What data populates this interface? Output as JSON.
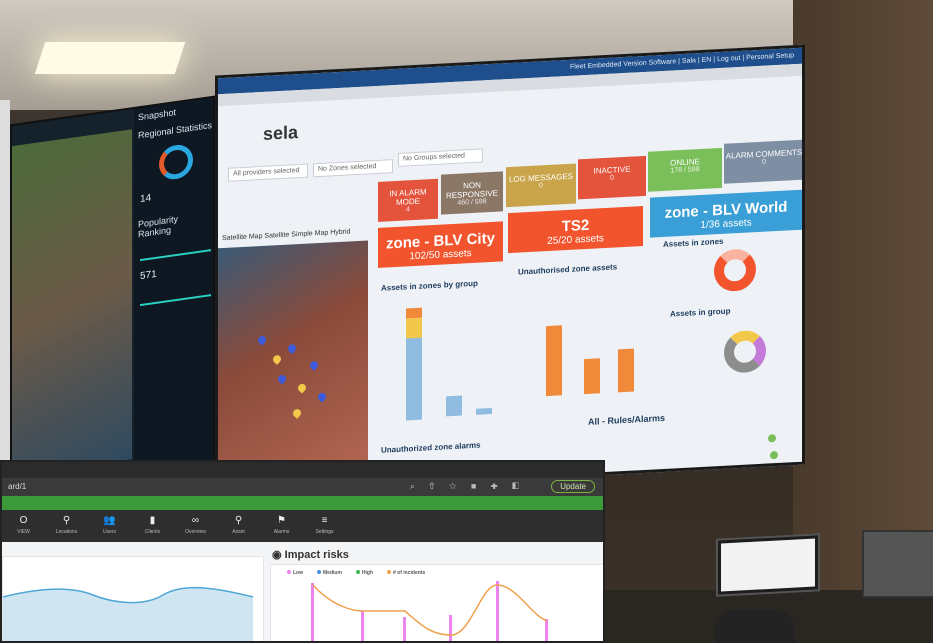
{
  "colors": {
    "alarm": "#e4543c",
    "non_responsive": "#8b7766",
    "log_messages": "#c9a44a",
    "inactive": "#e4543c",
    "online": "#7bbf5a",
    "alarm_comments": "#7f8fa3",
    "zone_blv": "#f2542d",
    "zone_world": "#3a9fd6",
    "bar_blue": "#8fbce0",
    "bar_orange": "#f08a3a",
    "bar_yellow": "#f2c84b",
    "green_bar": "#3d9a3b"
  },
  "video_wall": {
    "left_panel": {
      "title": "Snapshot",
      "section": "Regional Statistics",
      "section2": "Popularity Ranking",
      "gauge_value": "14",
      "stat1": "571"
    },
    "dashboard": {
      "top_bar": "Fleet Embedded Version Software | Sala | EN | Log out | Personal Setup",
      "logo": "sela",
      "dropdowns": [
        "All providers selected",
        "No Zones selected",
        "No Groups selected"
      ],
      "tiles": [
        {
          "label": "IN ALARM MODE",
          "value": "4"
        },
        {
          "label": "NON RESPONSIVE",
          "value": "460 / 598"
        },
        {
          "label": "LOG MESSAGES",
          "value": "0"
        },
        {
          "label": "INACTIVE",
          "value": "0"
        },
        {
          "label": "ONLINE",
          "value": "178 / 598"
        },
        {
          "label": "ALARM COMMENTS",
          "value": "0"
        }
      ],
      "zones": [
        {
          "name": "zone - BLV City",
          "assets": "102/50 assets"
        },
        {
          "name": "TS2",
          "assets": "25/20 assets"
        },
        {
          "name": "zone - BLV World",
          "assets": "1/36 assets"
        }
      ],
      "map_tabs": [
        "Satellite Map",
        "Satellite Simple",
        "Map",
        "Hybrid"
      ],
      "sections": {
        "assets_by_group": "Assets in zones by group",
        "unauthorised_assets": "Unauthorised zone assets",
        "assets_in_zones": "Assets in zones",
        "assets_in_group": "Assets in group",
        "unauthorized_alarms": "Unauthorized zone alarms",
        "rules_alarms": "All - Rules/Alarms"
      }
    }
  },
  "laptop": {
    "address": "ard/1",
    "update_label": "Update",
    "nav_items": [
      {
        "icon": "O",
        "label": "VIEW"
      },
      {
        "icon": "⚲",
        "label": "Locations"
      },
      {
        "icon": "👥",
        "label": "Users"
      },
      {
        "icon": "▮",
        "label": "Clients"
      },
      {
        "icon": "∞",
        "label": "Overview"
      },
      {
        "icon": "⚲",
        "label": "Asset"
      },
      {
        "icon": "⚑",
        "label": "Alarms"
      },
      {
        "icon": "≡",
        "label": "Settings"
      }
    ],
    "impact_title": "Impact risks",
    "legend": [
      {
        "label": "Low",
        "color": "#ee82ee"
      },
      {
        "label": "Medium",
        "color": "#4a90e2"
      },
      {
        "label": "High",
        "color": "#3fb950"
      },
      {
        "label": "# of incidents",
        "color": "#f0a04b"
      }
    ]
  }
}
